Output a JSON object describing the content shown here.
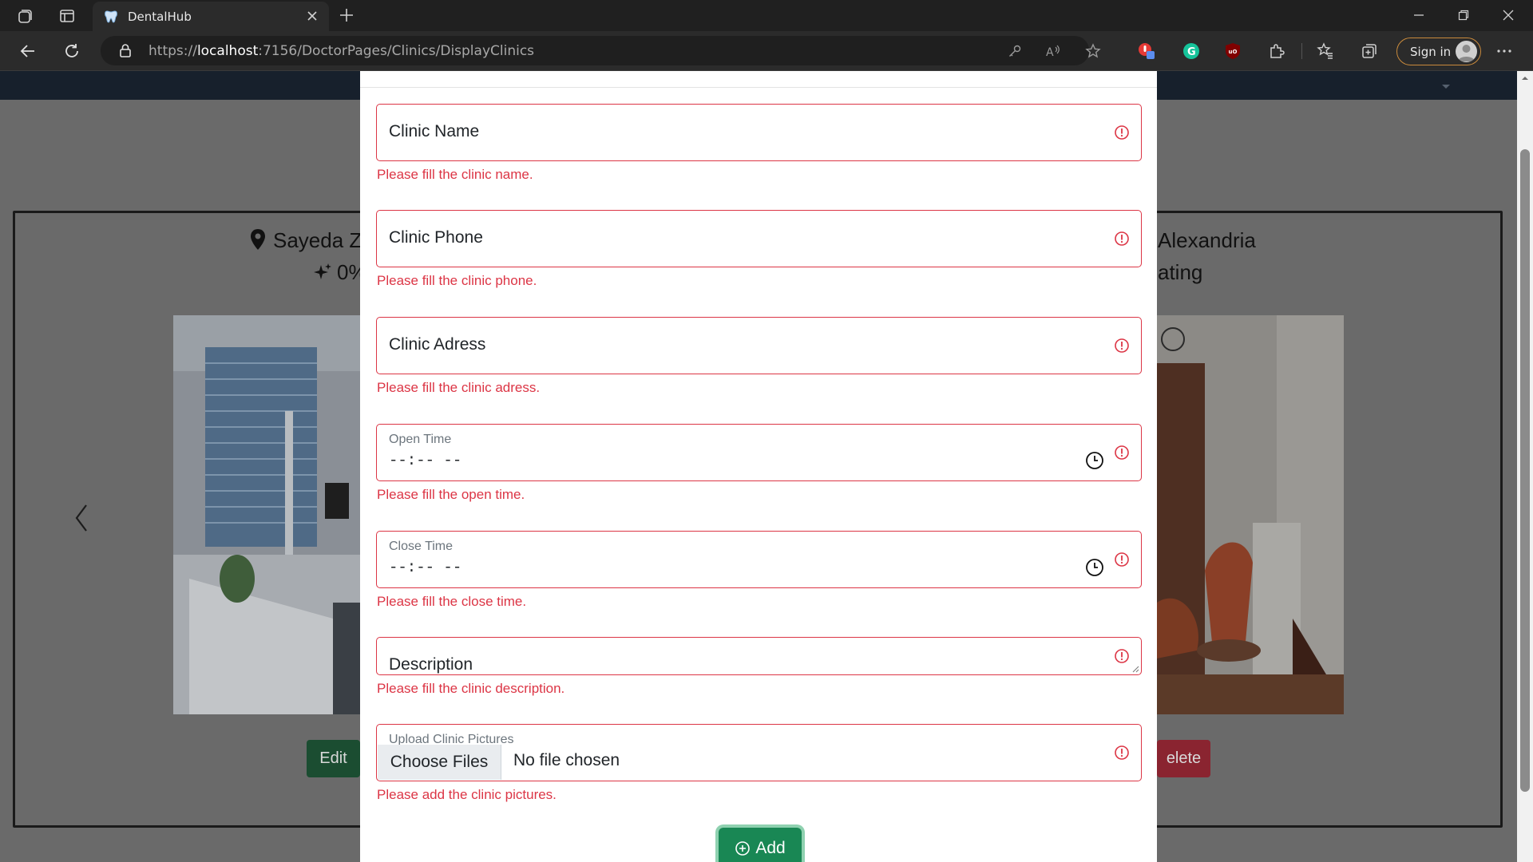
{
  "browser": {
    "tab_title": "DentalHub",
    "url_prefix": "https://",
    "url_host": "localhost",
    "url_path": ":7156/DoctorPages/Clinics/DisplayClinics",
    "signin_label": "Sign in"
  },
  "page": {
    "left_card": {
      "location": "Sayeda Z",
      "rating": "0%"
    },
    "right_card": {
      "location": "Alexandria",
      "rating": "ating"
    },
    "edit_label": "Edit",
    "delete_label": "elete"
  },
  "form": {
    "clinic_name": {
      "label": "Clinic Name",
      "error": "Please fill the clinic name."
    },
    "clinic_phone": {
      "label": "Clinic Phone",
      "error": "Please fill the clinic phone."
    },
    "clinic_address": {
      "label": "Clinic Adress",
      "error": "Please fill the clinic adress."
    },
    "open_time": {
      "label": "Open Time",
      "value": "--:-- --",
      "error": "Please fill the open time."
    },
    "close_time": {
      "label": "Close Time",
      "value": "--:-- --",
      "error": "Please fill the close time."
    },
    "description": {
      "label": "Description",
      "error": "Please fill the clinic description."
    },
    "pictures": {
      "label": "Upload Clinic Pictures",
      "choose_label": "Choose Files",
      "file_status": "No file chosen",
      "error": "Please add the clinic pictures."
    },
    "add_label": "Add"
  },
  "colors": {
    "error": "#dc3545",
    "success": "#198754",
    "header": "#17202c"
  }
}
